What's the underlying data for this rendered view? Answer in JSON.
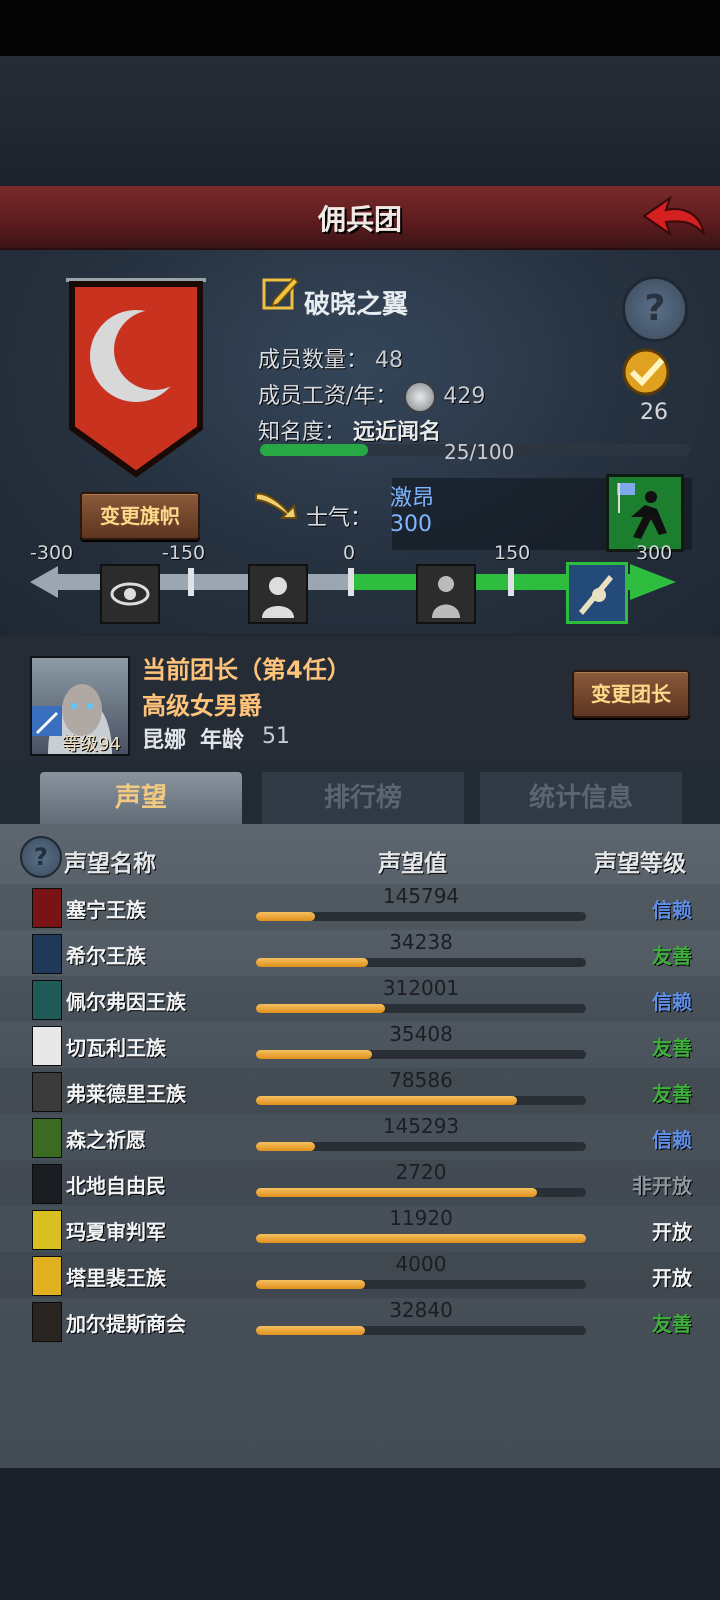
{
  "header": {
    "title": "佣兵团"
  },
  "clan": {
    "name": "破晓之翼",
    "members_label": "成员数量：",
    "members_value": "48",
    "salary_label": "成员工资/年：",
    "salary_value": "429",
    "fame_label": "知名度：",
    "fame_value": "远近闻名",
    "fame_progress": "25/100",
    "badge_count": "26",
    "change_banner_label": "变更旗帜"
  },
  "morale": {
    "label": "士气：",
    "name": "激昂",
    "value": "300",
    "scale_ticks": [
      "-300",
      "-150",
      "0",
      "150",
      "300"
    ]
  },
  "leader": {
    "title": "当前团长（第4任）",
    "rank": "高级女男爵",
    "name": "昆娜",
    "age_label": "年龄",
    "age": "51",
    "level_label": "等级94",
    "change_leader_label": "变更团长"
  },
  "tabs": [
    {
      "label": "声望"
    },
    {
      "label": "排行榜"
    },
    {
      "label": "统计信息"
    }
  ],
  "table": {
    "headers": [
      "声望名称",
      "声望值",
      "声望等级"
    ],
    "rows": [
      {
        "name": "塞宁王族",
        "value": "145794",
        "level": "信赖",
        "level_color": "#5f8fe8",
        "fill": 0.18,
        "crest": "#7a1414"
      },
      {
        "name": "希尔王族",
        "value": "34238",
        "level": "友善",
        "level_color": "#3fae3c",
        "fill": 0.34,
        "crest": "#1f3a58"
      },
      {
        "name": "佩尔弗因王族",
        "value": "312001",
        "level": "信赖",
        "level_color": "#5f8fe8",
        "fill": 0.39,
        "crest": "#1e5b58"
      },
      {
        "name": "切瓦利王族",
        "value": "35408",
        "level": "友善",
        "level_color": "#3fae3c",
        "fill": 0.35,
        "crest": "#e8e8e8"
      },
      {
        "name": "弗莱德里王族",
        "value": "78586",
        "level": "友善",
        "level_color": "#3fae3c",
        "fill": 0.79,
        "crest": "#3a3a3a"
      },
      {
        "name": "森之祈愿",
        "value": "145293",
        "level": "信赖",
        "level_color": "#5f8fe8",
        "fill": 0.18,
        "crest": "#3b6b22"
      },
      {
        "name": "北地自由民",
        "value": "2720",
        "level": "非开放",
        "level_color": "#8e969e",
        "fill": 0.85,
        "crest": "#1a1d21"
      },
      {
        "name": "玛夏审判军",
        "value": "11920",
        "level": "开放",
        "level_color": "#f0f2f4",
        "fill": 1.0,
        "crest": "#d8c020"
      },
      {
        "name": "塔里裴王族",
        "value": "4000",
        "level": "开放",
        "level_color": "#f0f2f4",
        "fill": 0.33,
        "crest": "#e0b020"
      },
      {
        "name": "加尔提斯商会",
        "value": "32840",
        "level": "友善",
        "level_color": "#3fae3c",
        "fill": 0.33,
        "crest": "#2a2520"
      }
    ]
  }
}
